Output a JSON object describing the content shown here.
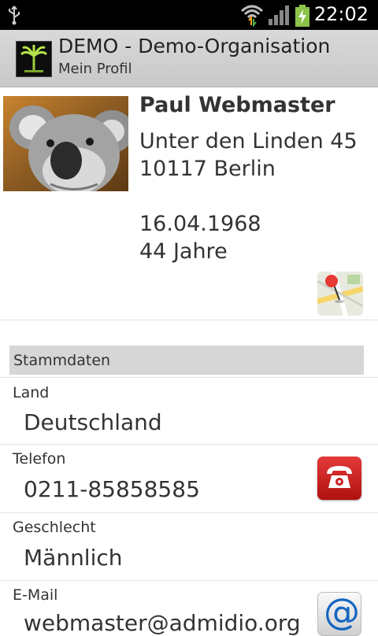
{
  "status_bar": {
    "time": "22:02"
  },
  "app_bar": {
    "title": "DEMO - Demo-Organisation",
    "subtitle": "Mein Profil"
  },
  "profile": {
    "name": "Paul Webmaster",
    "street": "Unter den Linden 45",
    "city": "10117 Berlin",
    "birthday": "16.04.1968",
    "age": "44 Jahre"
  },
  "section": {
    "title": "Stammdaten"
  },
  "fields": [
    {
      "label": "Land",
      "value": "Deutschland"
    },
    {
      "label": "Telefon",
      "value": "0211-85858585"
    },
    {
      "label": "Geschlecht",
      "value": "Männlich"
    },
    {
      "label": "E-Mail",
      "value": "webmaster@admidio.org"
    }
  ],
  "icons": {
    "map": "map-icon",
    "phone": "phone-icon",
    "email": "email-icon",
    "mail_symbol": "@"
  }
}
